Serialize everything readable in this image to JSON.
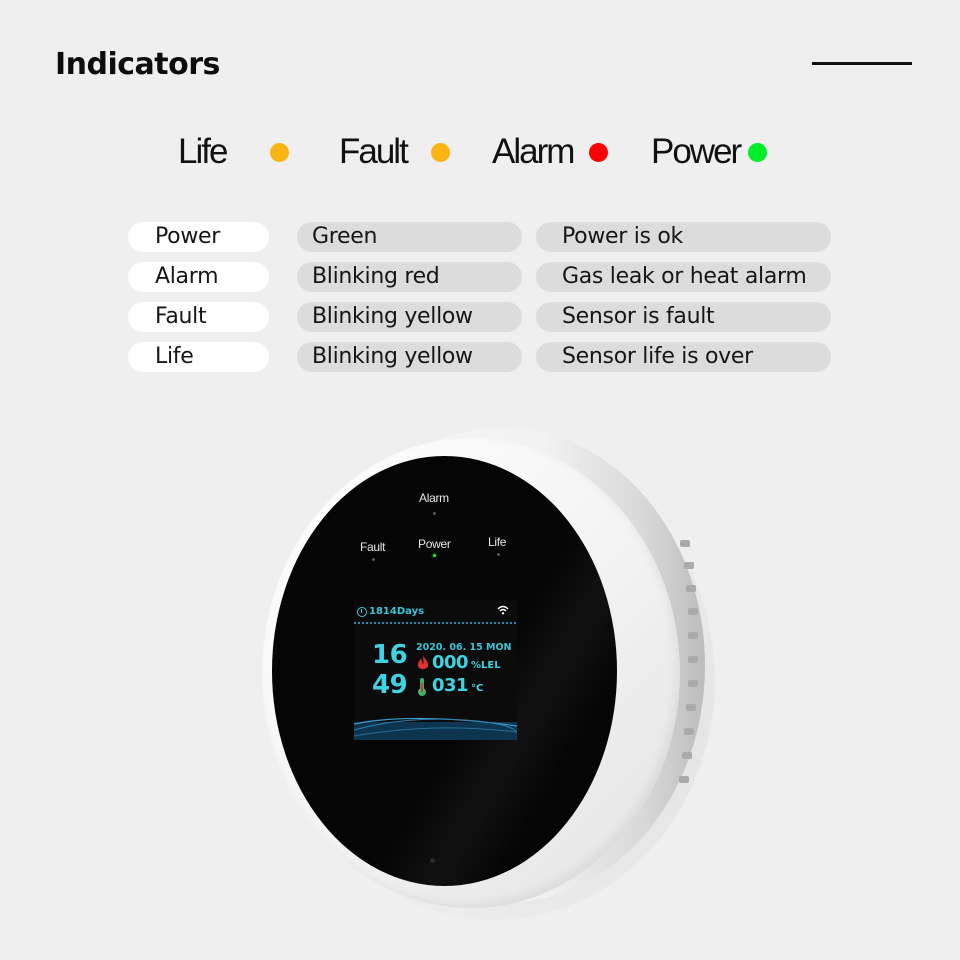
{
  "header": {
    "title": "Indicators"
  },
  "legend": [
    {
      "label": "Life",
      "color": "#fbb613"
    },
    {
      "label": "Fault",
      "color": "#fbb613"
    },
    {
      "label": "Alarm",
      "color": "#ff0000"
    },
    {
      "label": "Power",
      "color": "#00ee2a"
    }
  ],
  "table": {
    "rows": [
      {
        "indicator": "Power",
        "state": "Green",
        "meaning": "Power is ok"
      },
      {
        "indicator": "Alarm",
        "state": "Blinking red",
        "meaning": "Gas leak or heat alarm"
      },
      {
        "indicator": "Fault",
        "state": "Blinking yellow",
        "meaning": "Sensor is fault"
      },
      {
        "indicator": "Life",
        "state": "Blinking yellow",
        "meaning": "Sensor life is over"
      }
    ]
  },
  "device": {
    "led_labels": {
      "alarm": "Alarm",
      "fault": "Fault",
      "power": "Power",
      "life": "Life"
    },
    "led_power_color": "#3dde3d",
    "screen": {
      "days": "1814Days",
      "time_hour": "16",
      "time_minute": "49",
      "date": "2020. 06. 15  MON",
      "gas_value": "000",
      "gas_unit": "%LEL",
      "temp_value": "031",
      "temp_unit": "°C",
      "icons": [
        "clock-icon",
        "wifi-icon",
        "flame-icon",
        "thermometer-icon"
      ]
    }
  }
}
